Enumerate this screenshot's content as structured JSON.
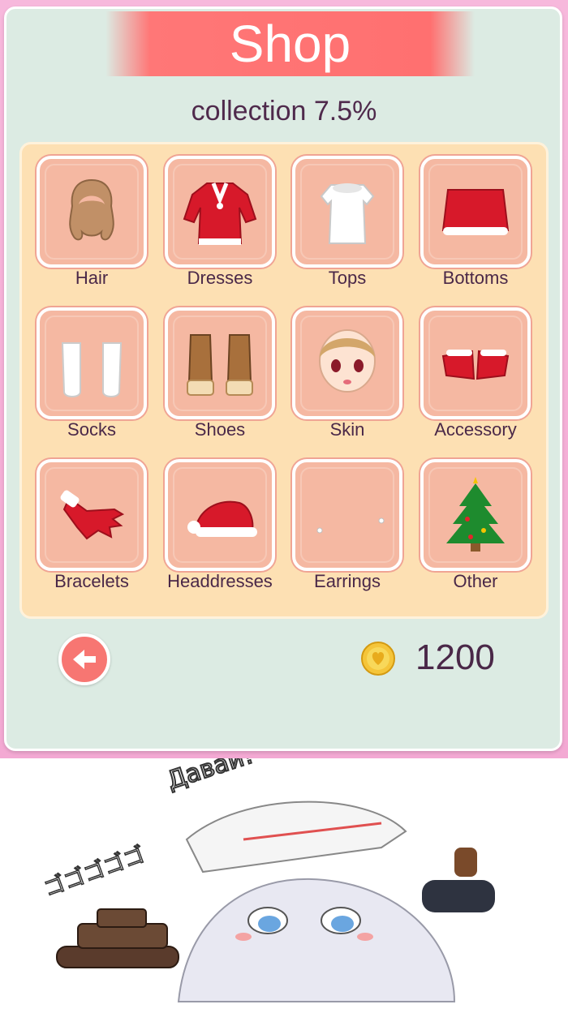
{
  "title": "Shop",
  "collection_text": "collection 7.5%",
  "categories": [
    {
      "label": "Hair",
      "icon": "hair-icon"
    },
    {
      "label": "Dresses",
      "icon": "dress-icon"
    },
    {
      "label": "Tops",
      "icon": "top-icon"
    },
    {
      "label": "Bottoms",
      "icon": "skirt-icon"
    },
    {
      "label": "Socks",
      "icon": "socks-icon"
    },
    {
      "label": "Shoes",
      "icon": "boots-icon"
    },
    {
      "label": "Skin",
      "icon": "face-icon"
    },
    {
      "label": "Accessory",
      "icon": "cuffs-icon"
    },
    {
      "label": "Bracelets",
      "icon": "glove-icon"
    },
    {
      "label": "Headdresses",
      "icon": "santa-hat-icon"
    },
    {
      "label": "Earrings",
      "icon": "earring-icon"
    },
    {
      "label": "Other",
      "icon": "christmas-tree-icon"
    }
  ],
  "coins": "1200",
  "banner_text": "Давай!",
  "banner_sfx": "ゴゴゴゴゴ"
}
